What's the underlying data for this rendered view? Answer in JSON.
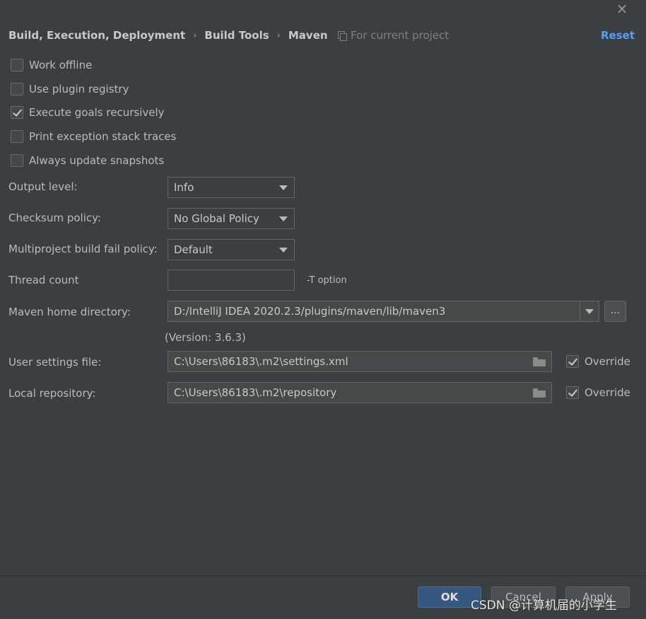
{
  "header": {
    "breadcrumb": [
      "Build, Execution, Deployment",
      "Build Tools",
      "Maven"
    ],
    "breadcrumb_separator": "›",
    "scope_label": "For current project",
    "reset_label": "Reset",
    "close_label": "×"
  },
  "options": [
    {
      "label": "Work offline",
      "checked": false
    },
    {
      "label": "Use plugin registry",
      "checked": false
    },
    {
      "label": "Execute goals recursively",
      "checked": true
    },
    {
      "label": "Print exception stack traces",
      "checked": false
    },
    {
      "label": "Always update snapshots",
      "checked": false
    }
  ],
  "output_level": {
    "label": "Output level:",
    "value": "Info"
  },
  "checksum_policy": {
    "label": "Checksum policy:",
    "value": "No Global Policy"
  },
  "fail_policy": {
    "label": "Multiproject build fail policy:",
    "value": "Default"
  },
  "thread_count": {
    "label": "Thread count",
    "value": "",
    "hint": "-T option"
  },
  "maven_home": {
    "label": "Maven home directory:",
    "value": "D:/IntelliJ IDEA 2020.2.3/plugins/maven/lib/maven3",
    "browse_label": "...",
    "version": "(Version: 3.6.3)"
  },
  "user_settings": {
    "label": "User settings file:",
    "value": "C:\\Users\\86183\\.m2\\settings.xml",
    "override_label": "Override",
    "override": true
  },
  "local_repo": {
    "label": "Local repository:",
    "value": "C:\\Users\\86183\\.m2\\repository",
    "override_label": "Override",
    "override": true
  },
  "footer": {
    "ok_label": "OK",
    "cancel_label": "Cancel",
    "apply_label": "Apply"
  },
  "watermark": "CSDN @计算机届的小学生",
  "colors": {
    "background": "#3c3f41",
    "accent": "#589df6",
    "ok_button": "#365880"
  }
}
